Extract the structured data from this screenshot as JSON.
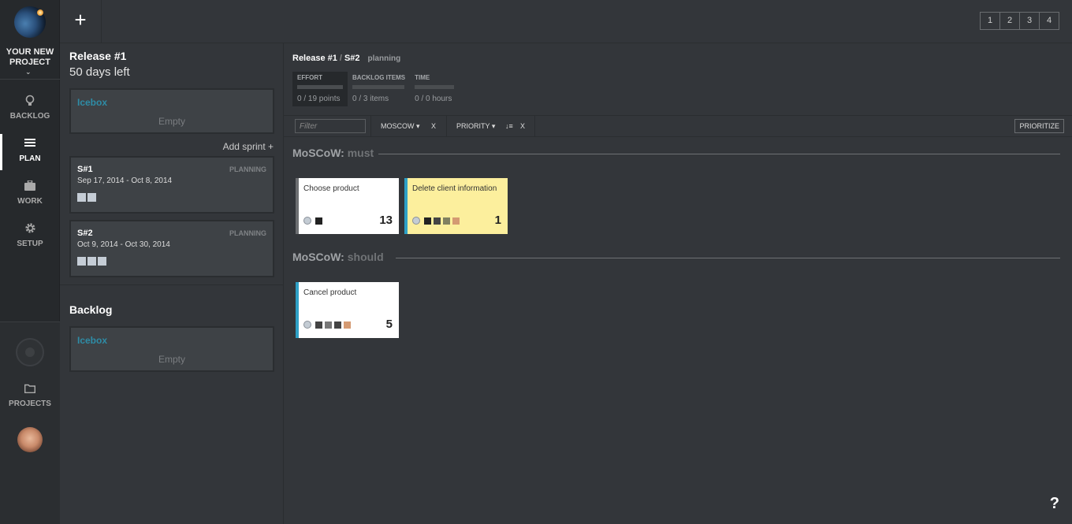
{
  "nav": {
    "project_name_line1": "YOUR NEW",
    "project_name_line2": "PROJECT",
    "chevron": "⌄",
    "items": [
      {
        "label": "BACKLOG",
        "icon": "lightbulb-icon"
      },
      {
        "label": "PLAN",
        "icon": "list-icon"
      },
      {
        "label": "WORK",
        "icon": "briefcase-icon"
      },
      {
        "label": "SETUP",
        "icon": "gear-icon"
      }
    ],
    "projects_label": "PROJECTS"
  },
  "topbar": {
    "add_label": "+",
    "pages": [
      "1",
      "2",
      "3",
      "4"
    ]
  },
  "release": {
    "title": "Release #1",
    "days_left": "50 days left",
    "icebox_label": "Icebox",
    "icebox_empty": "Empty",
    "add_sprint": "Add sprint +"
  },
  "sprints": [
    {
      "name": "S#1",
      "status": "PLANNING",
      "dates": "Sep 17, 2014 - Oct 8, 2014",
      "squares": 2
    },
    {
      "name": "S#2",
      "status": "PLANNING",
      "dates": "Oct 9, 2014 - Oct 30, 2014",
      "squares": 3
    }
  ],
  "backlog": {
    "title": "Backlog",
    "icebox_label": "Icebox",
    "icebox_empty": "Empty"
  },
  "main": {
    "crumb_release": "Release #1",
    "crumb_slash": "/",
    "crumb_sprint": "S#2",
    "crumb_status": "planning",
    "stats": [
      {
        "label": "EFFORT",
        "value": "0 / 19 points"
      },
      {
        "label": "BACKLOG ITEMS",
        "value": "0 / 3 items"
      },
      {
        "label": "TIME",
        "value": "0 / 0 hours"
      }
    ],
    "filter_placeholder": "Filter",
    "filter_moscow": "MOSCOW",
    "filter_priority": "PRIORITY",
    "filter_clear": "X",
    "sort_icon": "↓≡",
    "dropdown_icon": "▾",
    "prioritize": "PRIORITIZE"
  },
  "groups": [
    {
      "prefix": "MoSCoW:",
      "name": "must",
      "cards": [
        {
          "title": "Choose product",
          "points": "13",
          "style": "gray",
          "squares": [
            "#222222"
          ]
        },
        {
          "title": "Delete client information",
          "points": "1",
          "style": "yel",
          "squares": [
            "#222222",
            "#444444",
            "#808060",
            "#d49a72"
          ]
        }
      ]
    },
    {
      "prefix": "MoSCoW:",
      "name": "should",
      "cards": [
        {
          "title": "Cancel product",
          "points": "5",
          "style": "blue",
          "squares": [
            "#444444",
            "#777777",
            "#444444",
            "#d49a72"
          ]
        }
      ]
    }
  ],
  "help": "?"
}
